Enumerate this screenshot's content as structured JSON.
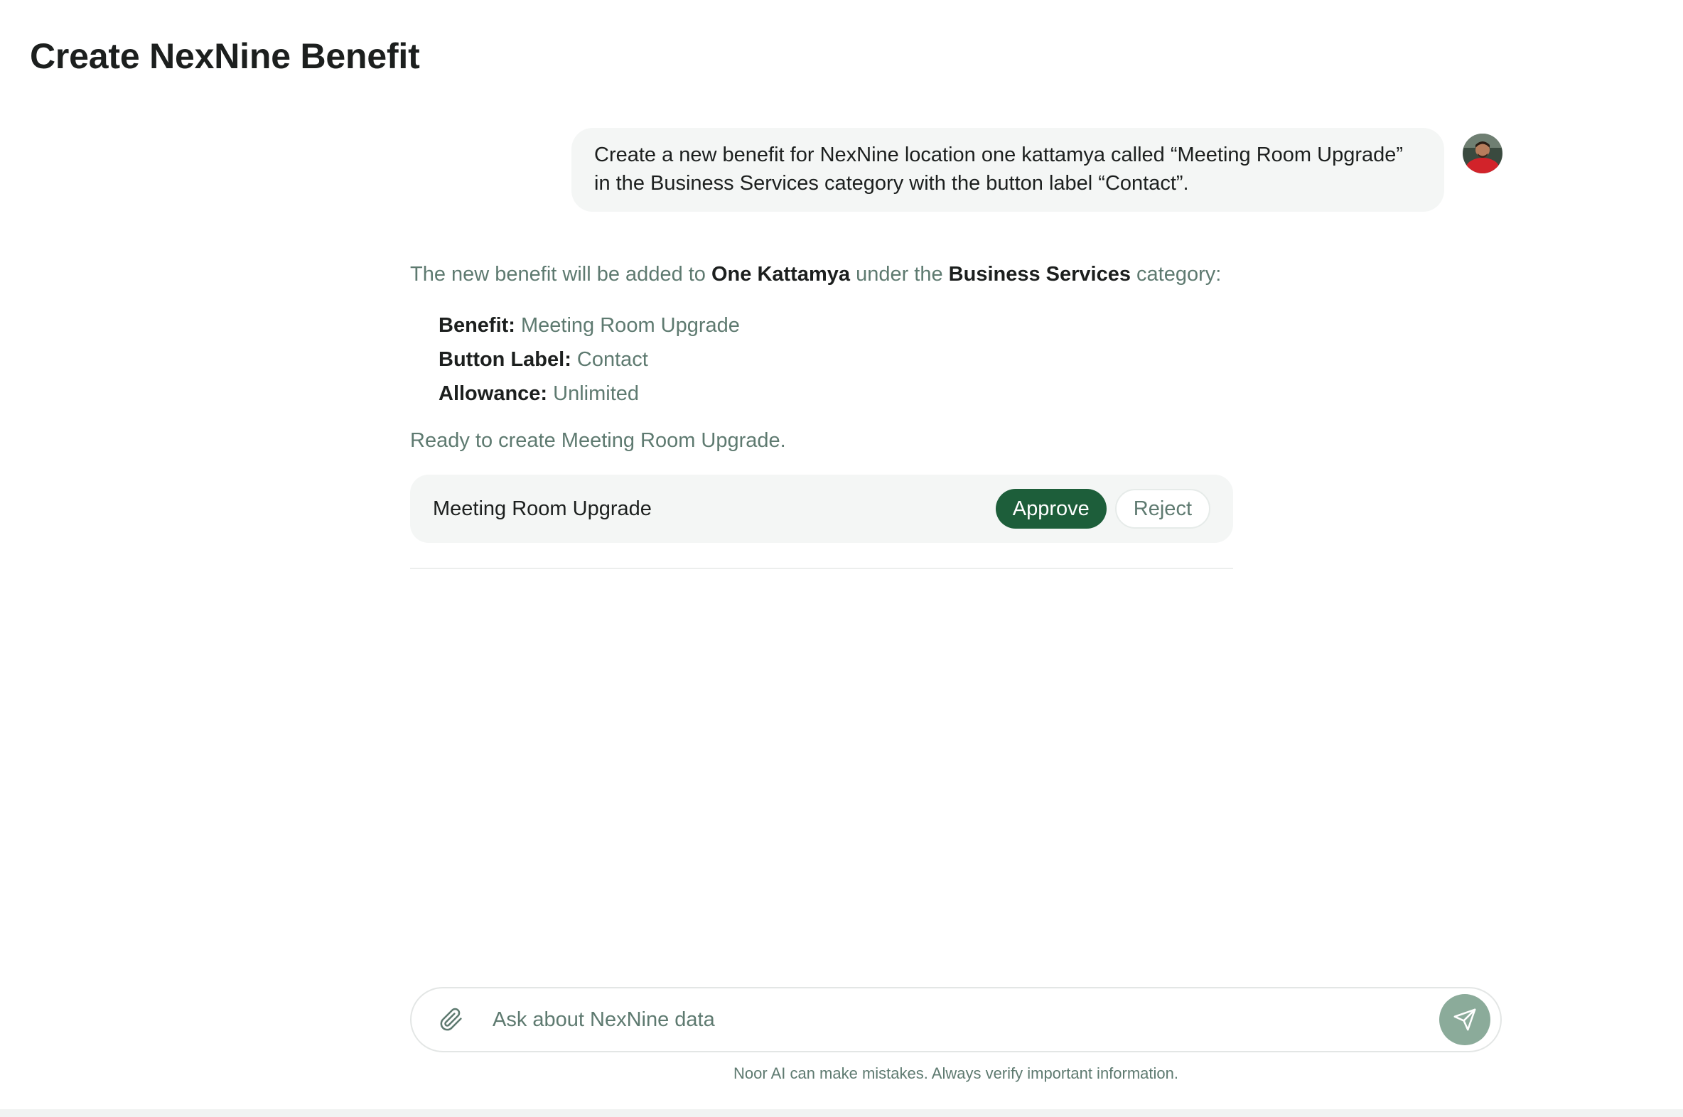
{
  "page": {
    "title": "Create NexNine Benefit"
  },
  "user_message": {
    "text": "Create a new benefit for NexNine location one kattamya called “Meeting Room Upgrade” in the Business Services category with the button label “Contact”."
  },
  "assistant": {
    "intro_prefix": "The new benefit will be added to ",
    "location": "One Kattamya",
    "intro_middle": " under the ",
    "category": "Business Services",
    "intro_suffix": " category:",
    "details": [
      {
        "key": "Benefit:",
        "value": "Meeting Room Upgrade"
      },
      {
        "key": "Button Label:",
        "value": "Contact"
      },
      {
        "key": "Allowance:",
        "value": "Unlimited"
      }
    ],
    "ready_text": "Ready to create Meeting Room Upgrade."
  },
  "action_card": {
    "title": "Meeting Room Upgrade",
    "approve_label": "Approve",
    "reject_label": "Reject"
  },
  "composer": {
    "placeholder": "Ask about NexNine data",
    "value": ""
  },
  "disclaimer": "Noor AI can make mistakes. Always verify important information.",
  "colors": {
    "accent": "#1d5e3a",
    "muted_text": "#5e7a70",
    "send_button": "#8bab9a",
    "bubble_bg": "#f4f6f5"
  },
  "icons": {
    "attach": "paperclip-icon",
    "send": "send-icon"
  }
}
